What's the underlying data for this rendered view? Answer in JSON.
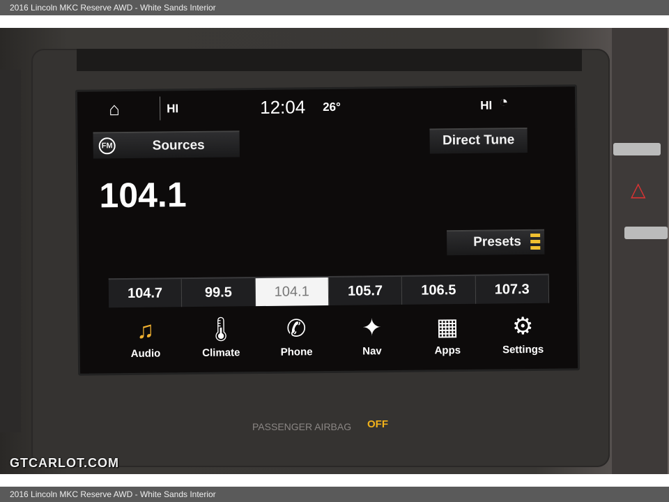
{
  "caption": "2016 Lincoln MKC Reserve AWD - White Sands Interior",
  "status": {
    "left_climate": "HI",
    "time": "12:04",
    "temperature": "26°",
    "right_climate": "HI"
  },
  "buttons": {
    "sources": "Sources",
    "source_icon_text": "FM",
    "direct_tune": "Direct Tune",
    "presets": "Presets"
  },
  "current_frequency": "104.1",
  "presets": [
    {
      "label": "104.7"
    },
    {
      "label": "99.5"
    },
    {
      "label": "104.1",
      "selected": true
    },
    {
      "label": "105.7"
    },
    {
      "label": "106.5"
    },
    {
      "label": "107.3"
    }
  ],
  "dock": [
    {
      "label": "Audio",
      "icon": "music-note-icon",
      "glyph": "♫",
      "color": "#f0b030"
    },
    {
      "label": "Climate",
      "icon": "thermometer-icon",
      "glyph": "🌡"
    },
    {
      "label": "Phone",
      "icon": "phone-icon",
      "glyph": "✆"
    },
    {
      "label": "Nav",
      "icon": "nav-star-icon",
      "glyph": "✦"
    },
    {
      "label": "Apps",
      "icon": "apps-grid-icon",
      "glyph": "▦"
    },
    {
      "label": "Settings",
      "icon": "gears-icon",
      "glyph": "⚙"
    }
  ],
  "dash": {
    "airbag_label": "PASSENGER AIRBAG",
    "airbag_status": "OFF"
  },
  "watermark": "GTCARLOT.COM"
}
